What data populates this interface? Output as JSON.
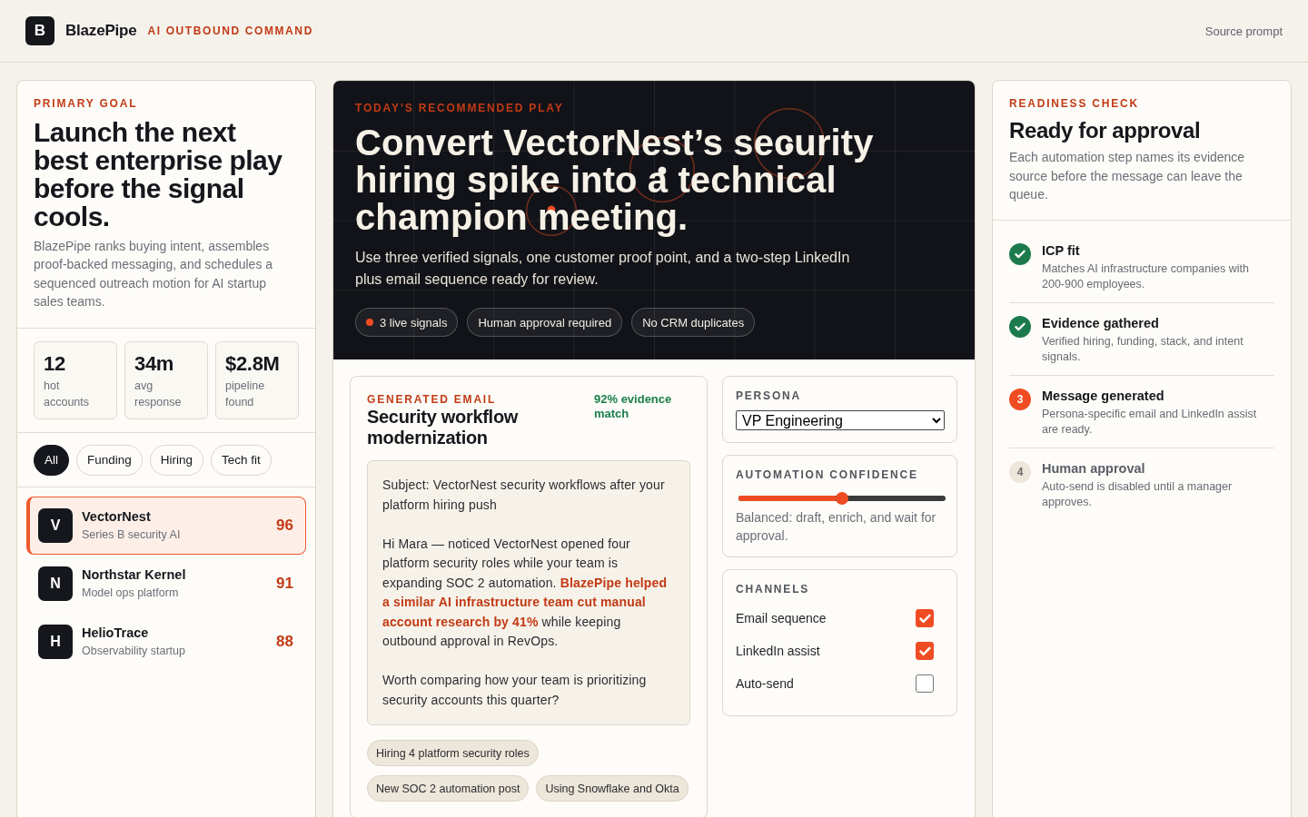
{
  "header": {
    "logo_letter": "B",
    "brand": "BlazePipe",
    "tagline": "AI OUTBOUND COMMAND",
    "source_link": "Source prompt"
  },
  "goal": {
    "eyebrow": "PRIMARY GOAL",
    "title": "Launch the next best enterprise play before the signal cools.",
    "description": "BlazePipe ranks buying intent, assembles proof-backed messaging, and schedules a sequenced outreach motion for AI startup sales teams."
  },
  "stats": [
    {
      "value": "12",
      "label": "hot accounts"
    },
    {
      "value": "34m",
      "label": "avg response"
    },
    {
      "value": "$2.8M",
      "label": "pipeline found"
    }
  ],
  "filters": [
    {
      "label": "All",
      "selected": true
    },
    {
      "label": "Funding",
      "selected": false
    },
    {
      "label": "Hiring",
      "selected": false
    },
    {
      "label": "Tech fit",
      "selected": false
    }
  ],
  "accounts": [
    {
      "initial": "V",
      "name": "VectorNest",
      "subtitle": "Series B security AI",
      "score": "96",
      "selected": true
    },
    {
      "initial": "N",
      "name": "Northstar Kernel",
      "subtitle": "Model ops platform",
      "score": "91",
      "selected": false
    },
    {
      "initial": "H",
      "name": "HelioTrace",
      "subtitle": "Observability startup",
      "score": "88",
      "selected": false
    }
  ],
  "play": {
    "eyebrow": "TODAY’S RECOMMENDED PLAY",
    "title": "Convert VectorNest’s security hiring spike into a technical champion meeting.",
    "description": "Use three verified signals, one customer proof point, and a two-step LinkedIn plus email sequence ready for review.",
    "pills": [
      {
        "label": "3 live signals",
        "live": true
      },
      {
        "label": "Human approval required",
        "live": false
      },
      {
        "label": "No CRM duplicates",
        "live": false
      }
    ]
  },
  "email": {
    "eyebrow": "GENERATED EMAIL",
    "title": "Security workflow modernization",
    "match": "92% evidence match",
    "paragraphs": [
      "Subject: VectorNest security workflows after your platform hiring push",
      "Hi Mara — noticed VectorNest opened four platform security roles while your team is expanding SOC 2 automation. **BlazePipe helped a similar AI infrastructure team cut manual account research by 41%** while keeping outbound approval in RevOps.",
      "Worth comparing how your team is prioritizing security accounts this quarter?"
    ],
    "evidence_tags": [
      "Hiring 4 platform security roles",
      "New SOC 2 automation post",
      "Using Snowflake and Okta"
    ]
  },
  "persona": {
    "label": "PERSONA",
    "value": "VP Engineering"
  },
  "automation": {
    "label": "AUTOMATION CONFIDENCE",
    "level": 0.5,
    "description": "Balanced: draft, enrich, and wait for approval."
  },
  "channels": {
    "label": "CHANNELS",
    "items": [
      {
        "label": "Email sequence",
        "checked": true
      },
      {
        "label": "LinkedIn assist",
        "checked": true
      },
      {
        "label": "Auto-send",
        "checked": false
      }
    ]
  },
  "readiness": {
    "eyebrow": "READINESS CHECK",
    "title": "Ready for approval",
    "description": "Each automation step names its evidence source before the message can leave the queue.",
    "steps": [
      {
        "done": true,
        "title": "ICP fit",
        "detail": "Matches AI infrastructure companies with 200-900 employees."
      },
      {
        "done": true,
        "title": "Evidence gathered",
        "detail": "Verified hiring, funding, stack, and intent signals."
      },
      {
        "done": false,
        "active": true,
        "number": "3",
        "title": "Message generated",
        "detail": "Persona-specific email and LinkedIn assist are ready."
      },
      {
        "done": false,
        "active": false,
        "number": "4",
        "title": "Human approval",
        "detail": "Auto-send is disabled until a manager approves."
      }
    ]
  }
}
